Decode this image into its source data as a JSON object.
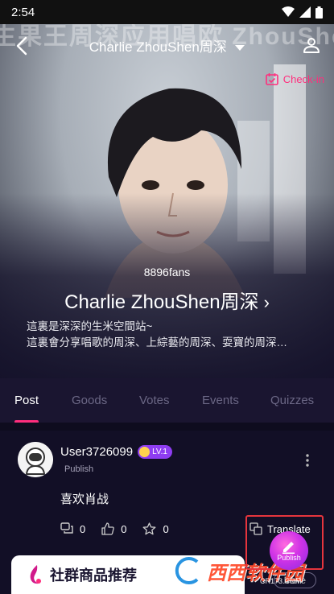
{
  "status": {
    "time": "2:54"
  },
  "header": {
    "title": "Charlie ZhouShen周深",
    "checkin_label": "Check-in"
  },
  "hero": {
    "banner_text": "生果王周深应用唱欧 ZhouShe",
    "fans": "8896fans",
    "community_name": "Charlie ZhouShen周深",
    "description_line1": "這裏是深深的生米空間站~",
    "description_line2": "這裏會分享唱歌的周深、上綜藝的周深、耍寶的周深…"
  },
  "tabs": [
    {
      "label": "Post",
      "active": true
    },
    {
      "label": "Goods",
      "active": false
    },
    {
      "label": "Votes",
      "active": false
    },
    {
      "label": "Events",
      "active": false
    },
    {
      "label": "Quizzes",
      "active": false
    }
  ],
  "post": {
    "username": "User3726099",
    "level": "LV.1",
    "sub_label": "Publish",
    "content": "喜欢肖战",
    "comments": "0",
    "likes": "0",
    "stars": "0",
    "translate_label": "Translate",
    "fab_label": "Publish"
  },
  "promo": {
    "title": "社群商品推荐",
    "more_label": "More"
  },
  "watermark": {
    "text": "西西软件园",
    "sub": "CR173.COM"
  },
  "colors": {
    "accent": "#ff2e7d",
    "background": "#14112a",
    "level_badge": "#8e3df2",
    "highlight_box": "#e6353d"
  }
}
